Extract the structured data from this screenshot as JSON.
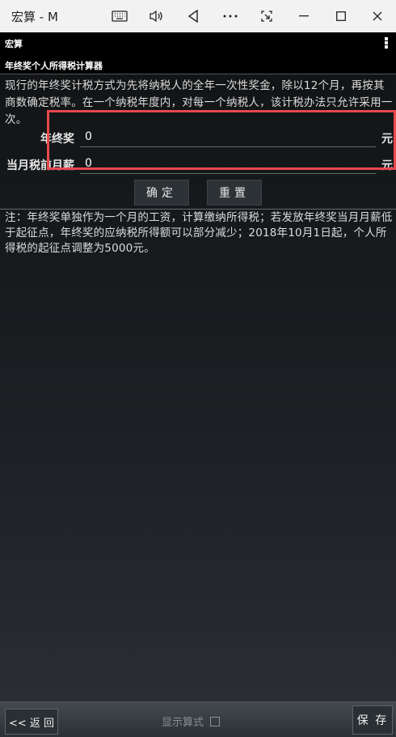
{
  "window": {
    "title": "宏算 - M",
    "icons": [
      "keyboard-icon",
      "volume-icon",
      "back-triangle-icon",
      "more-dots-icon",
      "snip-icon",
      "minimize-icon",
      "maximize-icon",
      "close-icon"
    ]
  },
  "app": {
    "name": "宏算",
    "page_title": "年终奖个人所得税计算器"
  },
  "intro_text": "现行的年终奖计税方式为先将纳税人的全年一次性奖金，除以12个月，再按其商数确定税率。在一个纳税年度内，对每一个纳税人，该计税办法只允许采用一次。",
  "form": {
    "bonus_label": "年终奖",
    "bonus_value": "0",
    "bonus_unit": "元",
    "salary_label": "当月税前月薪",
    "salary_value": "0",
    "salary_unit": "元",
    "confirm_label": "确定",
    "reset_label": "重置"
  },
  "note_text": "注：年终奖单独作为一个月的工资，计算缴纳所得税；若发放年终奖当月月薪低于起征点，年终奖的应纳税所得额可以部分减少；2018年10月1日起，个人所得税的起征点调整为5000元。",
  "bottom": {
    "back_label": "<< 返 回",
    "show_formula_label": "显示算式",
    "save_label": "保 存"
  },
  "colors": {
    "highlight_border": "#e8484e",
    "background": "#000000",
    "text": "#dcdcdc"
  }
}
